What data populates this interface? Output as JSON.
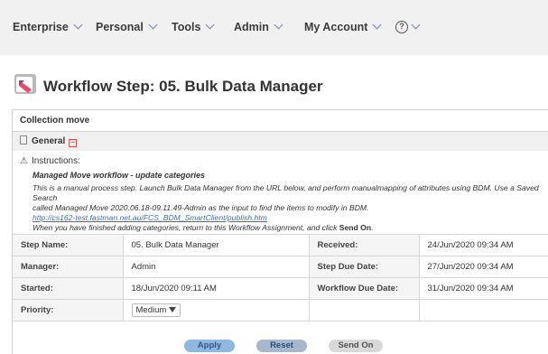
{
  "nav": {
    "items": [
      {
        "label": "Enterprise"
      },
      {
        "label": "Personal"
      },
      {
        "label": "Tools"
      },
      {
        "label": "Admin"
      },
      {
        "label": "My Account"
      }
    ],
    "help_icon": "question-circle-icon"
  },
  "page": {
    "title": "Workflow Step: 05. Bulk Data Manager",
    "icon": "workflow-step-icon"
  },
  "panel": {
    "header": "Collection move",
    "general_label": "General",
    "collapse_glyph": "−",
    "instructions_label": "Instructions:",
    "instructions": {
      "heading": "Managed Move workflow - update categories",
      "line1": "This is a manual process step. Launch Bulk Data Manager from the URL below, and perform manualmapping of attributes using BDM. Use a Saved Search",
      "line2": "called Managed Move 2020.06.18-09.11.49-Admin as the input to find the items to modify in BDM.",
      "link": "http://cs162-test.fastman.net.au/FCS_BDM_SmartClient/publish.htm",
      "line4_prefix": "When you have finished adding categories, return to this Workflow Assignment, and click ",
      "line4_bold": "Send On",
      "line4_suffix": "."
    }
  },
  "details": {
    "step_name_label": "Step Name:",
    "step_name": "05. Bulk Data Manager",
    "received_label": "Received:",
    "received": "24/Jun/2020 09:34 AM",
    "manager_label": "Manager:",
    "manager": "Admin",
    "step_due_label": "Step Due Date:",
    "step_due": "27/Jun/2020 09:34 AM",
    "started_label": "Started:",
    "started": "18/Jun/2020 09:11 AM",
    "workflow_due_label": "Workflow Due Date:",
    "workflow_due": "31/Jun/2020 09:34 AM",
    "priority_label": "Priority:",
    "priority": "Medium"
  },
  "buttons": {
    "apply": "Apply",
    "reset": "Reset",
    "send_on": "Send On"
  },
  "colors": {
    "nav_bg": "#f1f1f1",
    "chevron": "#6c83b6",
    "link": "#3b6fb6",
    "apply_bg": "#8fb7e0",
    "reset_bg": "#a8b8cc",
    "send_bg": "#d9d9d9"
  }
}
